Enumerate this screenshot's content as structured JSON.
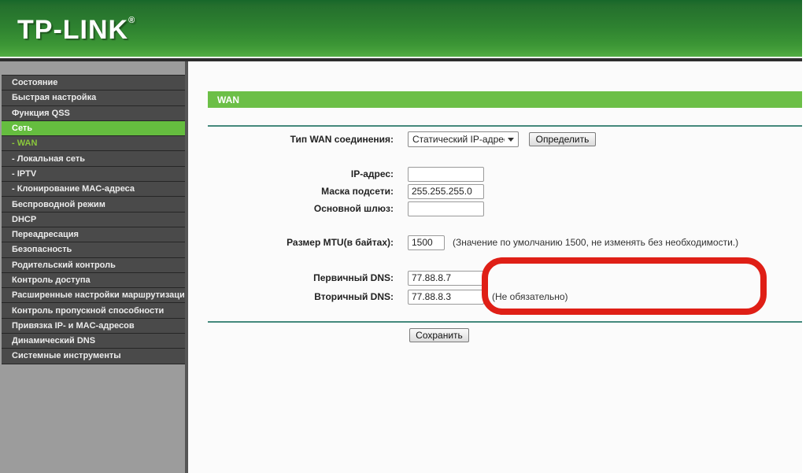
{
  "header": {
    "logo_text": "TP-LINK",
    "registered_mark": "®"
  },
  "sidebar": {
    "items": [
      {
        "label": "Состояние"
      },
      {
        "label": "Быстрая настройка"
      },
      {
        "label": "Функция QSS"
      },
      {
        "label": "Сеть",
        "active": true
      },
      {
        "label": "- WAN",
        "sub": true,
        "selected": true
      },
      {
        "label": "- Локальная сеть",
        "sub": true
      },
      {
        "label": "- IPTV",
        "sub": true
      },
      {
        "label": "- Клонирование MAC-адреса",
        "sub": true
      },
      {
        "label": "Беспроводной режим"
      },
      {
        "label": "DHCP"
      },
      {
        "label": "Переадресация"
      },
      {
        "label": "Безопасность"
      },
      {
        "label": "Родительский контроль"
      },
      {
        "label": "Контроль доступа"
      },
      {
        "label": "Расширенные настройки маршрутизации"
      },
      {
        "label": "Контроль пропускной способности"
      },
      {
        "label": "Привязка IP- и MAC-адресов"
      },
      {
        "label": "Динамический DNS"
      },
      {
        "label": "Системные инструменты"
      }
    ]
  },
  "main": {
    "section_title": "WAN",
    "form": {
      "wan_type_label": "Тип WAN соединения:",
      "wan_type_value": "Статический IP-адрес",
      "detect_button": "Определить",
      "ip_label": "IP-адрес:",
      "ip_value": "",
      "mask_label": "Маска подсети:",
      "mask_value": "255.255.255.0",
      "gateway_label": "Основной шлюз:",
      "gateway_value": "",
      "mtu_label": "Размер MTU(в байтах):",
      "mtu_value": "1500",
      "mtu_note": "(Значение по умолчанию 1500, не изменять без необходимости.)",
      "dns1_label": "Первичный DNS:",
      "dns1_value": "77.88.8.7",
      "dns2_label": "Вторичный DNS:",
      "dns2_value": "77.88.8.3",
      "dns2_note": "(Не обязательно)",
      "save_button": "Сохранить"
    }
  },
  "colors": {
    "header_green_top": "#17672a",
    "header_green_bottom": "#52ae43",
    "menu_item_bg": "#4a4a4a",
    "menu_active_green": "#65bd3f",
    "menu_selected_text_green": "#8ac83c",
    "sidebar_bg": "#9c9c9c",
    "section_bar_green": "#6cbf47",
    "rule_teal": "#44897c",
    "annotation_red": "#df1f16"
  }
}
